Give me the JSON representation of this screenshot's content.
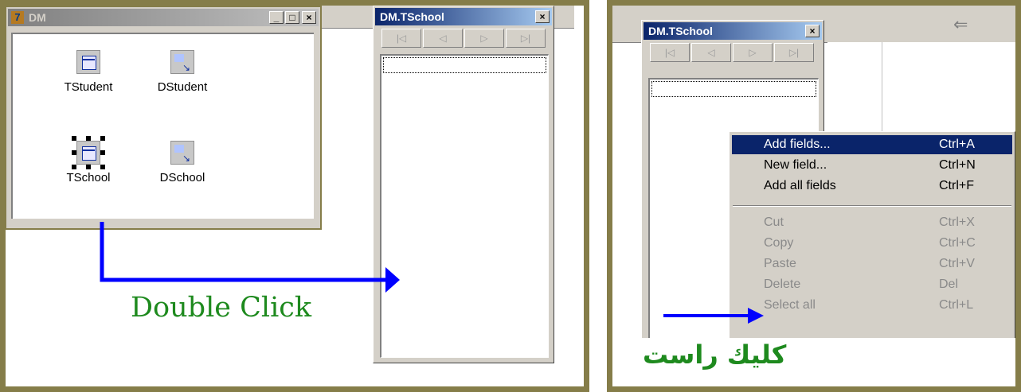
{
  "left": {
    "dm_window": {
      "title": "DM",
      "controls": [
        "_",
        "□",
        "×"
      ],
      "components": [
        {
          "label": "TStudent",
          "icon": "table-component-icon"
        },
        {
          "label": "DStudent",
          "icon": "datasource-component-icon"
        },
        {
          "label": "TSchool",
          "icon": "table-component-icon",
          "selected": true
        },
        {
          "label": "DSchool",
          "icon": "datasource-component-icon"
        }
      ]
    },
    "fields_window": {
      "title": "DM.TSchool",
      "close": "×",
      "nav": [
        "|◁",
        "◁",
        "▷",
        "▷|"
      ]
    },
    "annotation": "Double Click"
  },
  "right": {
    "fields_window": {
      "title": "DM.TSchool",
      "close": "×",
      "nav": [
        "|◁",
        "◁",
        "▷",
        "▷|"
      ]
    },
    "context_menu": {
      "group1": [
        {
          "label": "Add fields...",
          "shortcut": "Ctrl+A",
          "highlighted": true
        },
        {
          "label": "New field...",
          "shortcut": "Ctrl+N"
        },
        {
          "label": "Add all fields",
          "shortcut": "Ctrl+F"
        }
      ],
      "group2": [
        {
          "label": "Cut",
          "shortcut": "Ctrl+X",
          "disabled": true
        },
        {
          "label": "Copy",
          "shortcut": "Ctrl+C",
          "disabled": true
        },
        {
          "label": "Paste",
          "shortcut": "Ctrl+V",
          "disabled": true
        },
        {
          "label": "Delete",
          "shortcut": "Del",
          "disabled": true
        },
        {
          "label": "Select all",
          "shortcut": "Ctrl+L",
          "disabled": true
        }
      ]
    },
    "back_icon": "back-arrow-icon",
    "annotation": "كليك راست"
  },
  "colors": {
    "frame_border": "#857d49",
    "arrow": "#0000ff",
    "annotation_text": "#1e8a1e",
    "active_title": "#0a246a",
    "window_face": "#d4d0c8"
  }
}
